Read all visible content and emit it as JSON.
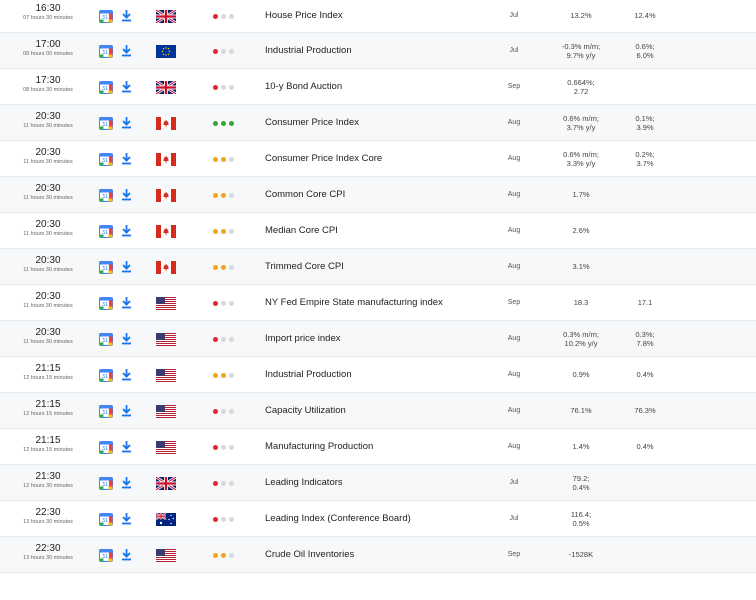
{
  "colors": {
    "impact_high": "#e0262f",
    "impact_medium": "#f3a31b",
    "impact_max": "#3aa335",
    "impact_off": "#d9d9d9"
  },
  "icons": {
    "calendar": "calendar-icon",
    "download": "download-icon"
  },
  "events": [
    {
      "time": "16:30",
      "remaining": "07 hours 30 minutes",
      "country": "uk",
      "impact": 1,
      "name": "House Price Index",
      "period": "Jul",
      "actual": [
        "13.2%"
      ],
      "previous": [
        "12.4%"
      ]
    },
    {
      "time": "17:00",
      "remaining": "08 hours 00 minutes",
      "country": "eu",
      "impact": 1,
      "name": "Industrial Production",
      "period": "Jul",
      "actual": [
        "-0.3% m/m;",
        "9.7% y/y"
      ],
      "previous": [
        "0.6%;",
        "6.0%"
      ]
    },
    {
      "time": "17:30",
      "remaining": "08 hours 30 minutes",
      "country": "uk",
      "impact": 1,
      "name": "10-y Bond Auction",
      "period": "Sep",
      "actual": [
        "0.664%;",
        "2.72"
      ],
      "previous": []
    },
    {
      "time": "20:30",
      "remaining": "11 hours 30 minutes",
      "country": "ca",
      "impact": 3,
      "name": "Consumer Price Index",
      "period": "Aug",
      "actual": [
        "0.6% m/m;",
        "3.7% y/y"
      ],
      "previous": [
        "0.1%;",
        "3.9%"
      ]
    },
    {
      "time": "20:30",
      "remaining": "11 hours 30 minutes",
      "country": "ca",
      "impact": 2,
      "name": "Consumer Price Index Core",
      "period": "Aug",
      "actual": [
        "0.6% m/m;",
        "3.3% y/y"
      ],
      "previous": [
        "0.2%;",
        "3.7%"
      ]
    },
    {
      "time": "20:30",
      "remaining": "11 hours 30 minutes",
      "country": "ca",
      "impact": 2,
      "name": "Common Core CPI",
      "period": "Aug",
      "actual": [
        "1.7%"
      ],
      "previous": []
    },
    {
      "time": "20:30",
      "remaining": "11 hours 30 minutes",
      "country": "ca",
      "impact": 2,
      "name": "Median Core CPI",
      "period": "Aug",
      "actual": [
        "2.6%"
      ],
      "previous": []
    },
    {
      "time": "20:30",
      "remaining": "11 hours 30 minutes",
      "country": "ca",
      "impact": 2,
      "name": "Trimmed Core CPI",
      "period": "Aug",
      "actual": [
        "3.1%"
      ],
      "previous": []
    },
    {
      "time": "20:30",
      "remaining": "11 hours 30 minutes",
      "country": "us",
      "impact": 1,
      "name": "NY Fed Empire State manufacturing index",
      "period": "Sep",
      "actual": [
        "18.3"
      ],
      "previous": [
        "17.1"
      ]
    },
    {
      "time": "20:30",
      "remaining": "11 hours 30 minutes",
      "country": "us",
      "impact": 1,
      "name": "Import price index",
      "period": "Aug",
      "actual": [
        "0.3% m/m;",
        "10.2% y/y"
      ],
      "previous": [
        "0.3%;",
        "7.8%"
      ]
    },
    {
      "time": "21:15",
      "remaining": "12 hours 15 minutes",
      "country": "us",
      "impact": 2,
      "name": "Industrial Production",
      "period": "Aug",
      "actual": [
        "0.9%"
      ],
      "previous": [
        "0.4%"
      ]
    },
    {
      "time": "21:15",
      "remaining": "12 hours 15 minutes",
      "country": "us",
      "impact": 1,
      "name": "Capacity Utilization",
      "period": "Aug",
      "actual": [
        "76.1%"
      ],
      "previous": [
        "76.3%"
      ]
    },
    {
      "time": "21:15",
      "remaining": "12 hours 15 minutes",
      "country": "us",
      "impact": 1,
      "name": "Manufacturing Production",
      "period": "Aug",
      "actual": [
        "1.4%"
      ],
      "previous": [
        "0.4%"
      ]
    },
    {
      "time": "21:30",
      "remaining": "12 hours 30 minutes",
      "country": "uk",
      "impact": 1,
      "name": "Leading Indicators",
      "period": "Jul",
      "actual": [
        "79.2;",
        "0.4%"
      ],
      "previous": []
    },
    {
      "time": "22:30",
      "remaining": "13 hours 30 minutes",
      "country": "au",
      "impact": 1,
      "name": "Leading Index (Conference Board)",
      "period": "Jul",
      "actual": [
        "116.4;",
        "0.5%"
      ],
      "previous": []
    },
    {
      "time": "22:30",
      "remaining": "13 hours 30 minutes",
      "country": "us",
      "impact": 2,
      "name": "Crude Oil Inventories",
      "period": "Sep",
      "actual": [
        "-1528K"
      ],
      "previous": []
    }
  ]
}
